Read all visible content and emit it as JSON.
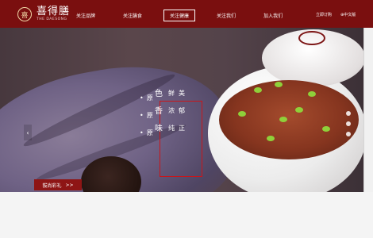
{
  "brand": {
    "name_cn": "喜得膳",
    "name_en": "THE DAESONG",
    "badge_glyph": "喜"
  },
  "nav": {
    "items": [
      {
        "label": "关注品牌",
        "active": false
      },
      {
        "label": "关注膳食",
        "active": false
      },
      {
        "label": "关注健康",
        "active": true
      },
      {
        "label": "关注我们",
        "active": false
      },
      {
        "label": "加入我们",
        "active": false
      }
    ]
  },
  "header_right": {
    "order_label": "立即订购",
    "language_label": "⊕中文版"
  },
  "hero": {
    "slogan": {
      "col1": [
        "原",
        "原",
        "原"
      ],
      "col2": [
        "色",
        "香",
        "味"
      ],
      "col3": [
        "鲜美",
        "浓郁",
        "纯正"
      ],
      "bullet": "•"
    },
    "cta_label": "拔尚彩礼",
    "cta_arrow": ">>",
    "prev_arrow": "‹"
  },
  "colors": {
    "brand_red": "#7a0f0f",
    "cta_red": "#8e1515",
    "frame_red": "#c9151a"
  }
}
